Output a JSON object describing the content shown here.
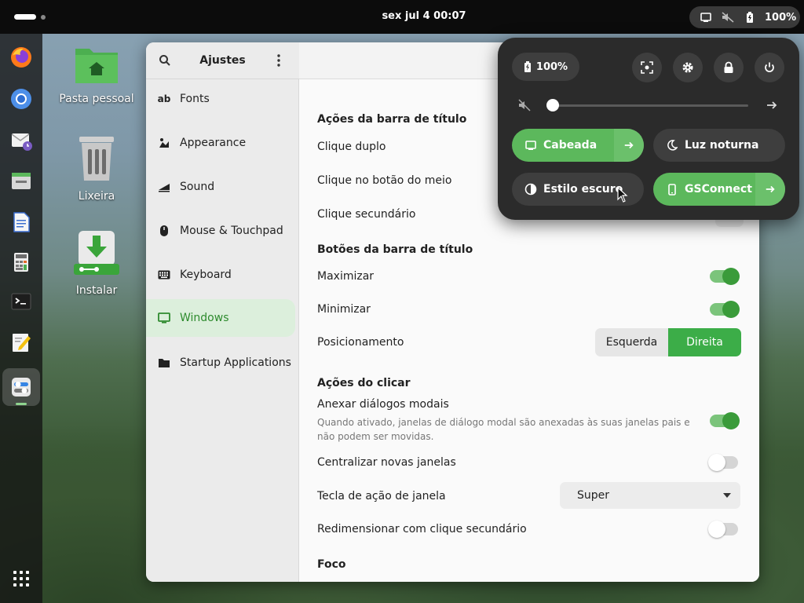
{
  "topbar": {
    "clock": "sex jul 4  00:07",
    "battery": "100%"
  },
  "desktop": {
    "icons": [
      {
        "label": "Pasta pessoal",
        "icon": "home-folder-icon"
      },
      {
        "label": "Lixeira",
        "icon": "trash-icon"
      },
      {
        "label": "Instalar",
        "icon": "install-icon"
      }
    ]
  },
  "dock": {
    "apps": [
      "firefox-icon",
      "chromium-icon",
      "mail-icon",
      "files-icon",
      "document-icon",
      "calculator-icon",
      "terminal-icon",
      "text-editor-icon",
      "settings-app-icon"
    ]
  },
  "settings": {
    "title": "Ajustes",
    "sidebar": [
      {
        "label": "Fonts",
        "icon": "fonts-icon"
      },
      {
        "label": "Appearance",
        "icon": "appearance-icon"
      },
      {
        "label": "Sound",
        "icon": "sound-icon"
      },
      {
        "label": "Mouse & Touchpad",
        "icon": "mouse-icon"
      },
      {
        "label": "Keyboard",
        "icon": "keyboard-icon"
      },
      {
        "label": "Windows",
        "icon": "windows-icon",
        "selected": true
      },
      {
        "label": "Startup Applications",
        "icon": "folder-icon"
      }
    ],
    "sections": {
      "titlebar_actions": "Ações da barra de título",
      "double_click": "Clique duplo",
      "middle_click": "Clique no botão do meio",
      "secondary_click": "Clique secundário",
      "titlebar_buttons": "Botões da barra de título",
      "maximize": "Maximizar",
      "minimize": "Minimizar",
      "placement": "Posicionamento",
      "placement_left": "Esquerda",
      "placement_right": "Direita",
      "click_actions": "Ações do clicar",
      "attach_modal": "Anexar diálogos modais",
      "attach_modal_desc": "Quando ativado, janelas de diálogo modal são anexadas às suas janelas pais e não podem ser movidas.",
      "center_windows": "Centralizar novas janelas",
      "action_key": "Tecla de ação de janela",
      "action_key_value": "Super",
      "resize_secondary": "Redimensionar com clique secundário",
      "focus": "Foco"
    },
    "toggles": {
      "maximize": true,
      "minimize": true,
      "attach_modal": true,
      "center_windows": false,
      "resize_secondary": false
    }
  },
  "quick_settings": {
    "battery": "100%",
    "volume_level": 0,
    "tiles": {
      "wired": "Cabeada",
      "night_light": "Luz noturna",
      "dark_style": "Estilo escuro",
      "gsconnect": "GSConnect"
    }
  },
  "colors": {
    "accent": "#3cad48",
    "selected_bg": "#dcefdc"
  }
}
